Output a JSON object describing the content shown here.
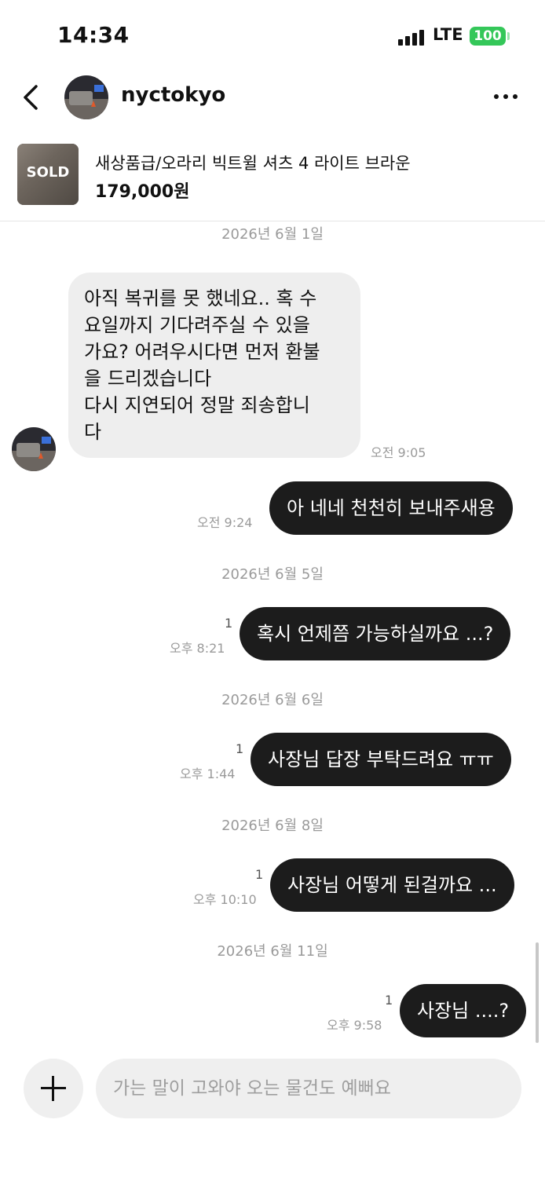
{
  "status_bar": {
    "time": "14:34",
    "network": "LTE",
    "battery": "100",
    "signal_icon": "signal-bars-icon"
  },
  "header": {
    "name": "nyctokyo",
    "back_icon": "chevron-left-icon",
    "more_icon": "more-horizontal-icon"
  },
  "product": {
    "thumb_label": "SOLD",
    "title": "새상품급/오라리 빅트윌 셔츠 4 라이트 브라운",
    "price": "179,000원"
  },
  "messages": [
    {
      "type": "date",
      "text": "2026년 6월 1일"
    },
    {
      "type": "in",
      "lines": [
        "아직 복귀를 못 했네요.. 혹 수",
        "요일까지 기다려주실 수 있을",
        "가요? 어려우시다면 먼저 환불",
        "을 드리겠습니다",
        "다시 지연되어 정말 죄송합니",
        "다"
      ],
      "time": "오전 9:05"
    },
    {
      "type": "out",
      "text": "아 네네 천천히 보내주새용",
      "time": "오전 9:24",
      "unread": ""
    },
    {
      "type": "date",
      "text": "2026년 6월 5일"
    },
    {
      "type": "out",
      "text": "혹시 언제쯤 가능하실까요 ...?",
      "time": "오후 8:21",
      "unread": "1"
    },
    {
      "type": "date",
      "text": "2026년 6월 6일"
    },
    {
      "type": "out",
      "text": "사장님 답장 부탁드려요 ㅠㅠ",
      "time": "오후 1:44",
      "unread": "1"
    },
    {
      "type": "date",
      "text": "2026년 6월 8일"
    },
    {
      "type": "out",
      "text": "사장님 어떻게 된걸까요 ...",
      "time": "오후 10:10",
      "unread": "1"
    },
    {
      "type": "date",
      "text": "2026년 6월 11일"
    },
    {
      "type": "out",
      "text": "사장님 ....?",
      "time": "오후 9:58",
      "unread": "1"
    }
  ],
  "composer": {
    "placeholder": "가는 말이 고와야 오는 물건도 예뻐요",
    "add_icon": "plus-icon"
  }
}
